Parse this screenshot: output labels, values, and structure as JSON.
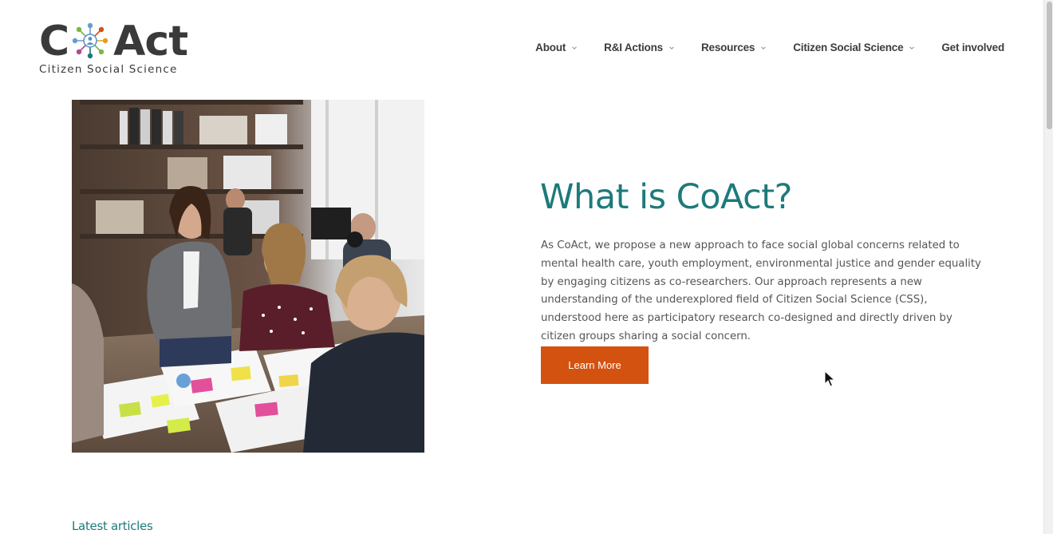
{
  "logo": {
    "word_left": "C",
    "word_right": "Act",
    "tagline": "Citizen Social Science"
  },
  "nav": {
    "items": [
      {
        "label": "About",
        "has_dropdown": true
      },
      {
        "label": "R&I Actions",
        "has_dropdown": true
      },
      {
        "label": "Resources",
        "has_dropdown": true
      },
      {
        "label": "Citizen Social Science",
        "has_dropdown": true
      },
      {
        "label": "Get involved",
        "has_dropdown": false
      }
    ]
  },
  "hero": {
    "title": "What is CoAct?",
    "body": "As CoAct, we propose a new approach to face social global concerns related to mental health care, youth employment, environmental justice and gender equality by engaging citizens as co-researchers. Our approach represents a new understanding of the underexplored field of Citizen Social Science (CSS), understood here as participatory research co-designed and directly driven by citizen groups sharing a social concern.",
    "button_label": "Learn More"
  },
  "latest": {
    "heading": "Latest articles"
  },
  "colors": {
    "accent": "#1e7a7a",
    "button": "#d4520f",
    "text": "#555555",
    "logo": "#3a3a3a"
  }
}
